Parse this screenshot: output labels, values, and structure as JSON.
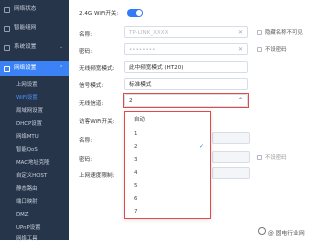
{
  "sidebar": {
    "top_items": [
      {
        "label": "网络状态"
      },
      {
        "label": "智能组网"
      },
      {
        "label": "系统设置"
      }
    ],
    "network_settings": {
      "label": "网络设置"
    },
    "sub_items": [
      {
        "label": "上网设置"
      },
      {
        "label": "WiFi设置"
      },
      {
        "label": "局域网设置"
      },
      {
        "label": "DHCP设置"
      },
      {
        "label": "网络MTU"
      },
      {
        "label": "智能QoS"
      },
      {
        "label": "MAC地址克隆"
      },
      {
        "label": "自定义HOST"
      },
      {
        "label": "静态路由"
      },
      {
        "label": "端口映射"
      },
      {
        "label": "DMZ"
      },
      {
        "label": "UPnP设置"
      },
      {
        "label": "网络工具"
      }
    ]
  },
  "form": {
    "wifi24_label": "2.4G WiFi开关:",
    "name_label": "名称:",
    "name_value": "TP-LINK_XXXX",
    "hide_network_label": "隐藏名称不可见",
    "password_label": "密码:",
    "password_value": "••••••••",
    "no_encrypt_label": "不设密码",
    "wireless_mode_label": "无线频宽模式:",
    "wireless_mode_value": "此中频宽模式 (HT20)",
    "signal_mode_label": "信号模式:",
    "signal_mode_value": "标准模式",
    "channel_label": "无线信道:",
    "channel_value": "2",
    "guest_label": "访客WiFi开关:",
    "guest_name_label": "名称:",
    "guest_password_label": "密码:",
    "guest_no_encrypt_label": "不设密码",
    "upload_limit_label": "上网速度限制:"
  },
  "dropdown": {
    "options": [
      "自动",
      "1",
      "2",
      "3",
      "4",
      "5",
      "6",
      "7"
    ],
    "selected_index": 2
  },
  "watermark": {
    "text": "@ 固电行业网"
  }
}
